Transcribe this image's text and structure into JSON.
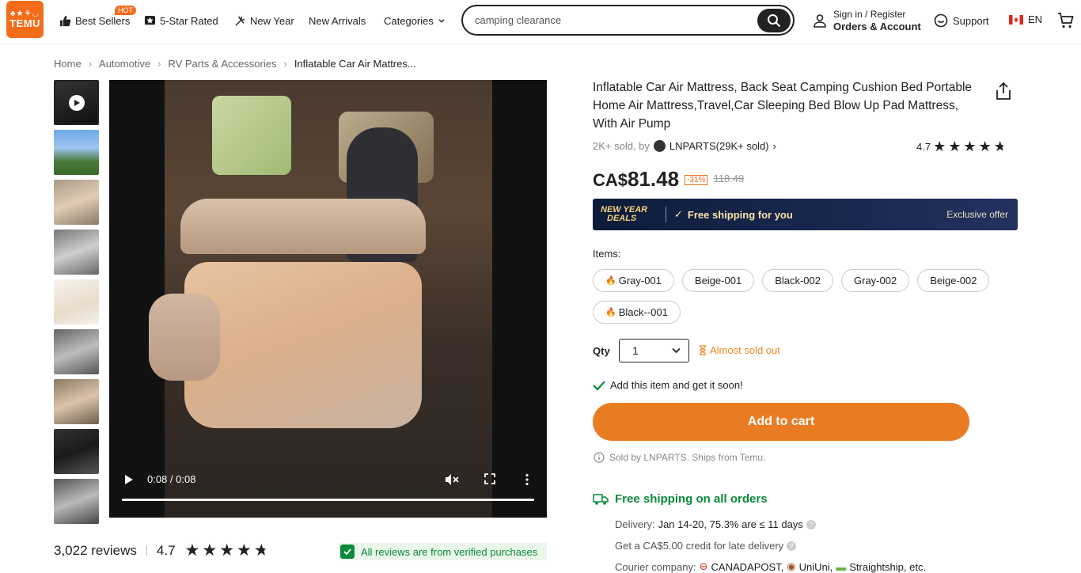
{
  "header": {
    "logo_text": "TEMU",
    "logo_glyphs": "♣★⚘◡",
    "nav": [
      {
        "label": "Best Sellers",
        "badge": "HOT"
      },
      {
        "label": "5-Star Rated"
      },
      {
        "label": "New Year"
      },
      {
        "label": "New Arrivals"
      },
      {
        "label": "Categories"
      }
    ],
    "search_value": "camping clearance",
    "account_line1": "Sign in / Register",
    "account_line2": "Orders & Account",
    "support": "Support",
    "language": "EN"
  },
  "breadcrumb": [
    "Home",
    "Automotive",
    "RV Parts & Accessories",
    "Inflatable Car Air Mattres..."
  ],
  "video": {
    "time": "0:08 / 0:08",
    "progress": 1.0
  },
  "product": {
    "title": "Inflatable Car Air Mattress, Back Seat Camping Cushion Bed Portable Home Air Mattress,Travel,Car Sleeping Bed Blow Up Pad Mattress, With Air Pump",
    "sold": "2K+ sold, by",
    "store": "LNPARTS(29K+ sold)",
    "rating": "4.7",
    "price_currency": "CA$",
    "price": "81.48",
    "discount": "-31%",
    "old_price": "118.49",
    "promo_title_1": "NEW YEAR",
    "promo_title_2": "DEALS",
    "promo_shipping": "Free shipping for you",
    "promo_exclusive": "Exclusive offer",
    "items_label": "Items:",
    "items": [
      {
        "label": "Gray-001",
        "hot": true
      },
      {
        "label": "Beige-001",
        "hot": false
      },
      {
        "label": "Black-002",
        "hot": false
      },
      {
        "label": "Gray-002",
        "hot": false
      },
      {
        "label": "Beige-002",
        "hot": false
      },
      {
        "label": "Black--001",
        "hot": true
      }
    ],
    "qty_label": "Qty",
    "qty_value": "1",
    "almost_sold_out": "Almost sold out",
    "add_soon": "Add this item and get it soon!",
    "add_to_cart": "Add to cart",
    "sold_by": "Sold by LNPARTS. Ships from Temu.",
    "free_shipping": "Free shipping on all orders",
    "delivery_label": "Delivery:",
    "delivery_value": "Jan 14-20, 75.3% are ≤ 11 days",
    "late_credit": "Get a CA$5.00 credit for late delivery",
    "courier_label": "Courier company:",
    "couriers": [
      "CANADAPOST,",
      "UniUni,",
      "Straightship, etc."
    ]
  },
  "reviews": {
    "count": "3,022 reviews",
    "score": "4.7",
    "verified": "All reviews are from verified purchases"
  },
  "colors": {
    "brand": "#f26c1a",
    "cart_button": "#e97c23",
    "green": "#0a8a3a"
  }
}
